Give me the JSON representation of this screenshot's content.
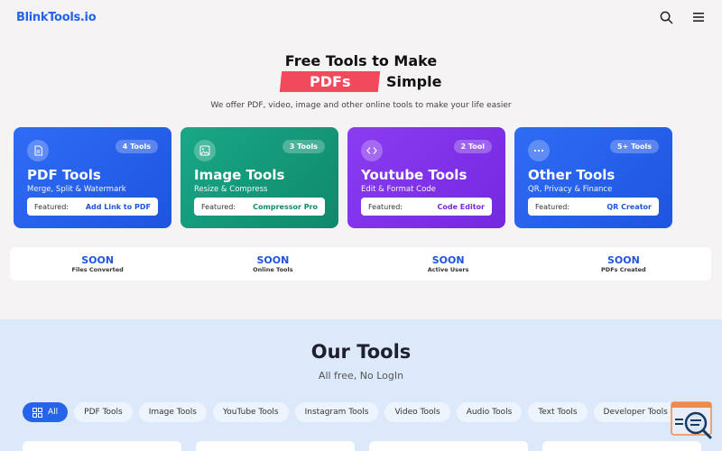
{
  "header": {
    "logo": "BlinkTools.io",
    "search_icon": "search-icon",
    "menu_icon": "hamburger-menu-icon"
  },
  "hero": {
    "line1": "Free Tools to Make",
    "highlight": "PDFs",
    "line2_end": "Simple",
    "subtitle": "We offer PDF, video, image and other online tools to make your life easier"
  },
  "cards": [
    {
      "title": "PDF Tools",
      "badge": "4 Tools",
      "sub": "Merge, Split & Watermark",
      "featured_label": "Featured:",
      "featured": "Add Link to PDF",
      "icon": "document-icon",
      "color": "#2f6cf6"
    },
    {
      "title": "Image Tools",
      "badge": "3 Tools",
      "sub": "Resize & Compress",
      "featured_label": "Featured:",
      "featured": "Compressor Pro",
      "icon": "image-icon",
      "color": "#18a886"
    },
    {
      "title": "Youtube Tools",
      "badge": "2 Tool",
      "sub": "Edit & Format Code",
      "featured_label": "Featured:",
      "featured": "Code Editor",
      "icon": "code-icon",
      "color": "#8b3cf0"
    },
    {
      "title": "Other Tools",
      "badge": "5+ Tools",
      "sub": "QR, Privacy & Finance",
      "featured_label": "Featured:",
      "featured": "QR Creator",
      "icon": "dots-icon",
      "color": "#2f6cf6"
    }
  ],
  "stats": [
    {
      "value": "SOON",
      "label": "Files Converted"
    },
    {
      "value": "SOON",
      "label": "Online Tools"
    },
    {
      "value": "SOON",
      "label": "Active Users"
    },
    {
      "value": "SOON",
      "label": "PDFs Created"
    }
  ],
  "tools": {
    "title": "Our Tools",
    "subtitle": "All free, No LogIn",
    "filters": [
      "All",
      "PDF Tools",
      "Image Tools",
      "YouTube Tools",
      "Instagram Tools",
      "Video Tools",
      "Audio Tools",
      "Text Tools",
      "Developer Tools"
    ],
    "active_filter": "All"
  }
}
